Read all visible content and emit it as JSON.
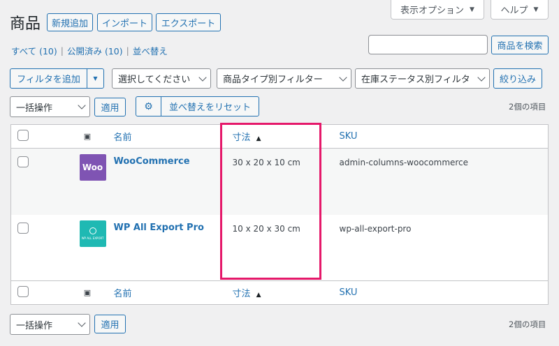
{
  "top": {
    "screen_options": "表示オプション",
    "help": "ヘルプ"
  },
  "header": {
    "title": "商品",
    "add_new": "新規追加",
    "import": "インポート",
    "export": "エクスポート"
  },
  "views": {
    "all": "すべて (10)",
    "published": "公開済み (10)",
    "sorting": "並べ替え"
  },
  "search": {
    "placeholder": "",
    "button": "商品を検索"
  },
  "filters": {
    "add_filter": "フィルタを追加",
    "category_select": "選択してください",
    "product_type": "商品タイプ別フィルター",
    "stock_status": "在庫ステータス別フィルタ",
    "filter_button": "絞り込み"
  },
  "bulk": {
    "action": "一括操作",
    "apply": "適用",
    "reset_sort": "並べ替えをリセット",
    "item_count": "2個の項目"
  },
  "table": {
    "columns": {
      "name": "名前",
      "dimensions": "寸法",
      "sku": "SKU"
    },
    "rows": [
      {
        "thumb_text": "Woo",
        "name": "WooCommerce",
        "dimensions": "30 x 20 x 10 cm",
        "sku": "admin-columns-woocommerce"
      },
      {
        "thumb_text": "WP ALL EXPORT",
        "name": "WP All Export Pro",
        "dimensions": "10 x 20 x 30 cm",
        "sku": "wp-all-export-pro"
      }
    ]
  },
  "colors": {
    "link": "#2271b1",
    "highlight": "#e5186a",
    "woo": "#7f54b3",
    "wpae": "#1fb9b3"
  }
}
